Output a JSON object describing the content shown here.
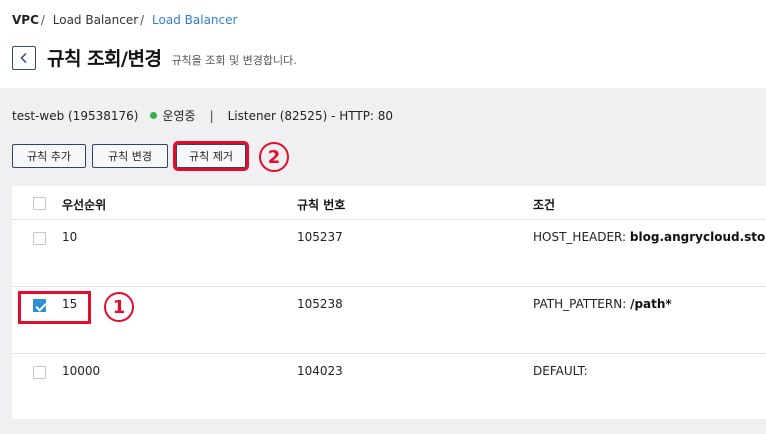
{
  "breadcrumb": {
    "items": [
      "VPC",
      "Load Balancer",
      "Load Balancer"
    ],
    "separator": "/"
  },
  "header": {
    "title": "규칙 조회/변경",
    "description": "규칙을 조회 및 변경합니다."
  },
  "info": {
    "lb_name": "test-web (19538176)",
    "status": "운영중",
    "status_color": "#2fb34a",
    "pipe": "|",
    "listener": "Listener (82525) - HTTP: 80"
  },
  "buttons": {
    "add": "규칙 추가",
    "change": "규칙 변경",
    "remove": "규칙 제거"
  },
  "annotations": {
    "step1": "1",
    "step2": "2",
    "highlight_color": "#e30d2b"
  },
  "table": {
    "columns": [
      "우선순위",
      "규칙 번호",
      "조건"
    ],
    "rows": [
      {
        "priority": "10",
        "rule_no": "105237",
        "cond_key": "HOST_HEADER:",
        "cond_val": "blog.angrycloud.store",
        "checked": false
      },
      {
        "priority": "15",
        "rule_no": "105238",
        "cond_key": "PATH_PATTERN:",
        "cond_val": "/path*",
        "checked": true
      },
      {
        "priority": "10000",
        "rule_no": "104023",
        "cond_key": "DEFAULT:",
        "cond_val": "",
        "checked": false
      }
    ]
  }
}
